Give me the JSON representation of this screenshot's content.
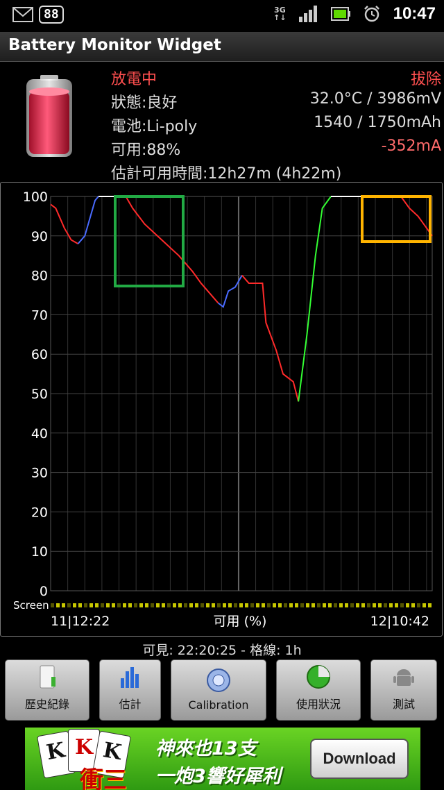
{
  "status_bar": {
    "notification_count": "88",
    "network": "3G",
    "time": "10:47"
  },
  "app": {
    "title": "Battery Monitor Widget"
  },
  "info": {
    "state": "放電中",
    "plug": "拔除",
    "health": "狀態:良好",
    "temp_voltage": "32.0°C / 3986mV",
    "battery_type": "電池:Li-poly",
    "capacity": "1540 / 1750mAh",
    "available": "可用:88%",
    "current": "-352mA",
    "estimate": "估計可用時間:12h27m (4h22m)"
  },
  "chart_data": {
    "type": "line",
    "ylabel": "可用 (%)",
    "ylim": [
      0,
      100
    ],
    "yticks": [
      "100",
      "90",
      "80",
      "70",
      "60",
      "50",
      "40",
      "30",
      "20",
      "10",
      "0"
    ],
    "x_start_label": "11|12:22",
    "x_end_label": "12|10:42",
    "screen_label": "Screen",
    "grid": true,
    "x_unit": "hours",
    "xlim": [
      0,
      22.33
    ],
    "series": [
      {
        "color": "#ff2a2a",
        "points": [
          [
            0,
            98
          ],
          [
            0.3,
            97
          ],
          [
            0.8,
            92
          ],
          [
            1.2,
            89
          ],
          [
            1.6,
            88
          ]
        ]
      },
      {
        "color": "#4a6bff",
        "points": [
          [
            1.6,
            88
          ],
          [
            2.0,
            90
          ],
          [
            2.6,
            99
          ],
          [
            2.8,
            100
          ]
        ]
      },
      {
        "color": "#ffffff",
        "points": [
          [
            2.8,
            100
          ],
          [
            4.4,
            100
          ]
        ]
      },
      {
        "color": "#ff2a2a",
        "points": [
          [
            4.4,
            100
          ],
          [
            4.8,
            97
          ],
          [
            5.5,
            93
          ],
          [
            6.5,
            89
          ],
          [
            7.5,
            85
          ],
          [
            8.3,
            81
          ],
          [
            8.8,
            78
          ],
          [
            9.2,
            76
          ],
          [
            9.6,
            74
          ],
          [
            9.8,
            73
          ]
        ]
      },
      {
        "color": "#4a6bff",
        "points": [
          [
            9.8,
            73
          ],
          [
            10.1,
            72
          ],
          [
            10.4,
            76
          ],
          [
            10.8,
            77
          ],
          [
            11.2,
            80
          ]
        ]
      },
      {
        "color": "#ff2a2a",
        "points": [
          [
            11.2,
            80
          ],
          [
            11.6,
            78
          ],
          [
            12.4,
            78
          ],
          [
            12.6,
            68
          ],
          [
            13.2,
            61
          ],
          [
            13.6,
            55
          ],
          [
            14.2,
            53
          ],
          [
            14.5,
            48
          ]
        ]
      },
      {
        "color": "#33ff33",
        "points": [
          [
            14.5,
            48
          ],
          [
            15.0,
            65
          ],
          [
            15.5,
            85
          ],
          [
            15.9,
            97
          ],
          [
            16.4,
            100
          ]
        ]
      },
      {
        "color": "#ffffff",
        "points": [
          [
            16.4,
            100
          ],
          [
            20.5,
            100
          ]
        ]
      },
      {
        "color": "#ff2a2a",
        "points": [
          [
            20.5,
            100
          ],
          [
            21.0,
            97
          ],
          [
            21.5,
            95
          ],
          [
            22.0,
            92
          ],
          [
            22.33,
            90
          ]
        ]
      }
    ]
  },
  "chart_caption": "可見: 22:20:25 - 格線: 1h",
  "buttons": [
    {
      "label": "歷史紀錄",
      "icon": "history-icon"
    },
    {
      "label": "估計",
      "icon": "estimate-chart-icon"
    },
    {
      "label": "Calibration",
      "icon": "calibration-icon"
    },
    {
      "label": "使用狀況",
      "icon": "usage-pie-icon"
    },
    {
      "label": "測試",
      "icon": "android-robot-icon"
    }
  ],
  "ad": {
    "title_line1": "神來也13支",
    "title_line2": "一炮3響好犀利",
    "button": "Download",
    "logo": "衝三",
    "cards": [
      "K",
      "K",
      "K"
    ]
  },
  "colors": {
    "discharge": "#ff2a2a",
    "charge": "#33ff33",
    "screen_on": "#4a6bff",
    "highlight_green": "#22aa44",
    "highlight_orange": "#ffb400"
  }
}
